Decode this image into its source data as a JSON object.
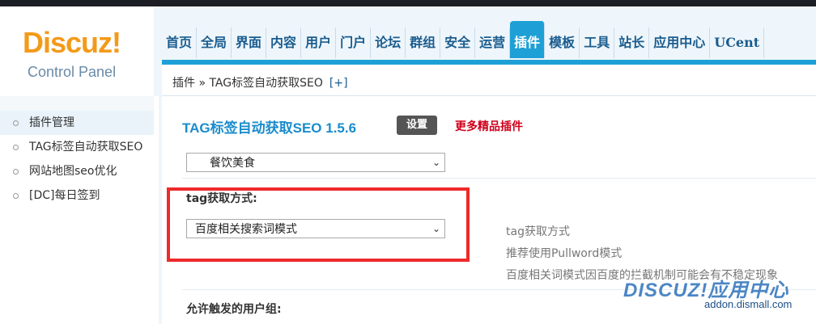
{
  "app": {
    "logo": "Discuz!",
    "logo_sub": "Control Panel"
  },
  "nav": {
    "items": [
      "首页",
      "全局",
      "界面",
      "内容",
      "用户",
      "门户",
      "论坛",
      "群组",
      "安全",
      "运营",
      "插件",
      "模板",
      "工具",
      "站长",
      "应用中心",
      "UCent"
    ],
    "active": "插件"
  },
  "breadcrumb": {
    "path": "插件 » TAG标签自动获取SEO",
    "plus": "[+]"
  },
  "sidebar": {
    "items": [
      "插件管理",
      "TAG标签自动获取SEO",
      "网站地图seo优化",
      "[DC]每日签到"
    ],
    "active_index": 0
  },
  "main": {
    "plugin_title": "TAG标签自动获取SEO 1.5.6",
    "settings_button": "设置",
    "more_link": "更多精品插件",
    "select_top": "餐饮美食",
    "tag_label": "tag获取方式:",
    "tag_select": "百度相关搜索词模式",
    "hints": [
      "tag获取方式",
      "推荐使用Pullword模式",
      "百度相关词模式因百度的拦截机制可能会有不稳定现象"
    ],
    "usergroup_label": "允许触发的用户组:"
  },
  "watermark": {
    "main": "DISCUZ!应用中心",
    "sub": "addon.dismall.com"
  },
  "colors": {
    "accent": "#1ea0d6",
    "highlight_box": "#ee2a2a",
    "more_link": "#d0001b"
  }
}
